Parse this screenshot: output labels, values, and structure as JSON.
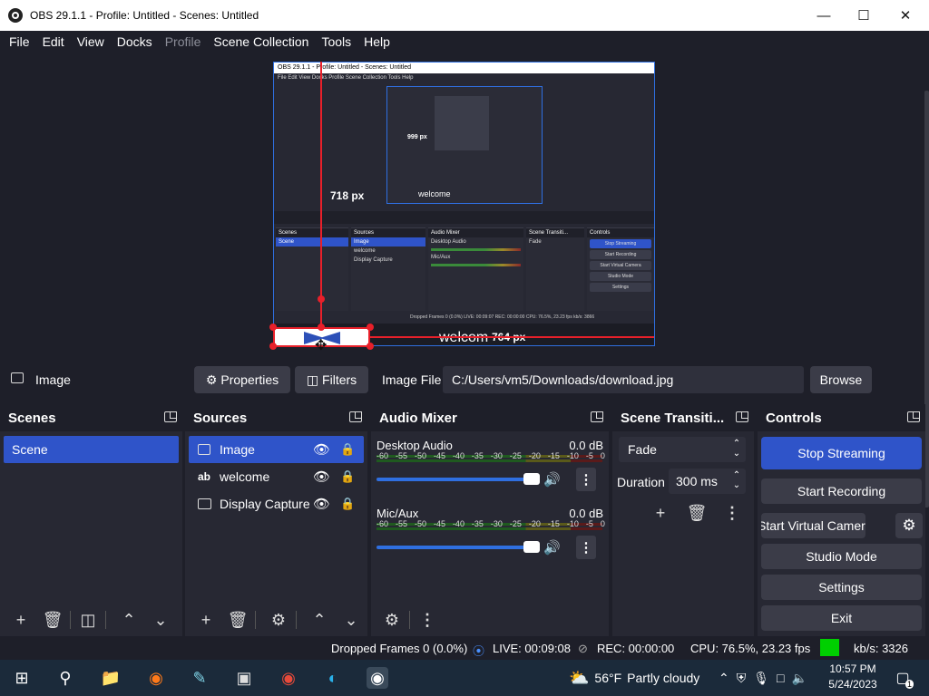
{
  "window": {
    "title": "OBS 29.1.1 - Profile: Untitled - Scenes: Untitled"
  },
  "menu": [
    "File",
    "Edit",
    "View",
    "Docks",
    "Profile",
    "Scene Collection",
    "Tools",
    "Help"
  ],
  "preview": {
    "mini_title": "OBS 29.1.1 - Profile: Untitled - Scenes: Untitled",
    "mini_menu": "File  Edit  View  Docks  Profile  Scene Collection  Tools  Help",
    "distance_label_1": "718 px",
    "distance_label_2": "764 px",
    "mini_distance_label": "999 px",
    "welcome_text": "welcom",
    "mini_welcome_text": "welcome"
  },
  "properties_bar": {
    "source_name": "Image",
    "properties_label": "Properties",
    "filters_label": "Filters",
    "image_file_label": "Image File",
    "image_file_path": "C:/Users/vm5/Downloads/download.jpg",
    "browse_label": "Browse"
  },
  "scenes": {
    "title": "Scenes",
    "items": [
      "Scene"
    ]
  },
  "sources": {
    "title": "Sources",
    "items": [
      "Image",
      "welcome",
      "Display Capture"
    ]
  },
  "mixer": {
    "title": "Audio Mixer",
    "tracks": [
      {
        "name": "Desktop Audio",
        "db": "0.0 dB"
      },
      {
        "name": "Mic/Aux",
        "db": "0.0 dB"
      }
    ],
    "scale": [
      "-60",
      "-55",
      "-50",
      "-45",
      "-40",
      "-35",
      "-30",
      "-25",
      "-20",
      "-15",
      "-10",
      "-5",
      "0"
    ]
  },
  "transitions": {
    "title": "Scene Transiti...",
    "selected": "Fade",
    "duration_label": "Duration",
    "duration_value": "300 ms"
  },
  "controls": {
    "title": "Controls",
    "stop_streaming": "Stop Streaming",
    "start_recording": "Start Recording",
    "start_virtual_camera": "Start Virtual Camera",
    "studio_mode": "Studio Mode",
    "settings": "Settings",
    "exit": "Exit"
  },
  "status": {
    "dropped_frames": "Dropped Frames 0 (0.0%)",
    "live": "LIVE: 00:09:08",
    "rec": "REC: 00:00:00",
    "cpu": "CPU: 76.5%, 23.23 fps",
    "kbps": "kb/s: 3326"
  },
  "taskbar": {
    "weather_temp": "56°F",
    "weather_desc": "Partly cloudy",
    "time": "10:57 PM",
    "date": "5/24/2023",
    "notification_count": "1"
  },
  "colors": {
    "accent": "#2f54c9",
    "guide_red": "#e8202a",
    "stream_ok": "#00d000"
  }
}
